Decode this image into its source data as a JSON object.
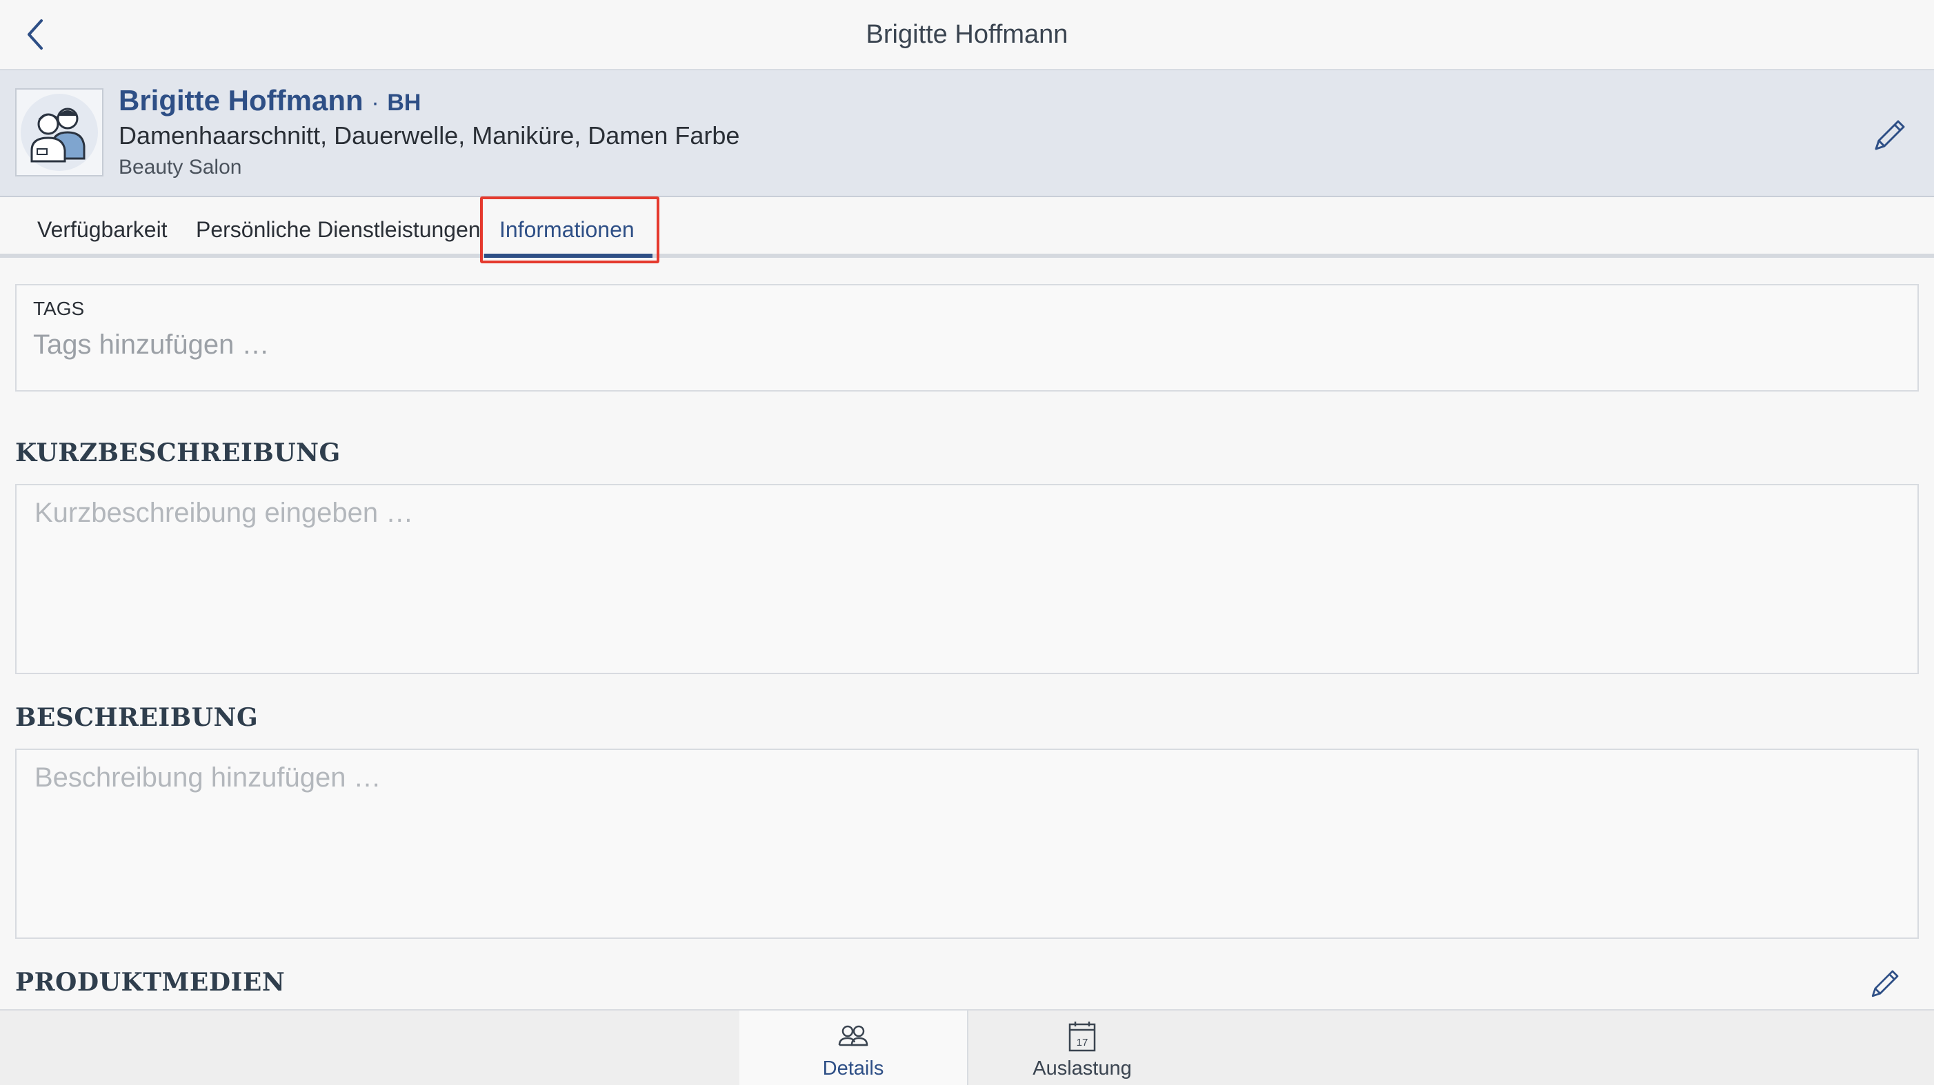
{
  "header": {
    "title": "Brigitte Hoffmann"
  },
  "profile": {
    "name": "Brigitte Hoffmann",
    "separator": "·",
    "initials": "BH",
    "services": "Damenhaarschnitt, Dauerwelle, Maniküre, Damen Farbe",
    "salon": "Beauty Salon"
  },
  "tabs": [
    {
      "label": "Verfügbarkeit"
    },
    {
      "label": "Persönliche Dienstleistungen"
    },
    {
      "label": "Informationen"
    }
  ],
  "active_tab": "Informationen",
  "tags": {
    "label": "TAGS",
    "placeholder": "Tags hinzufügen …"
  },
  "short_description": {
    "title": "KURZBESCHREIBUNG",
    "placeholder": "Kurzbeschreibung eingeben …"
  },
  "description": {
    "title": "BESCHREIBUNG",
    "placeholder": "Beschreibung hinzufügen …"
  },
  "product_media": {
    "title": "PRODUKTMEDIEN"
  },
  "bottom_nav": [
    {
      "label": "Details",
      "icon": "people-icon"
    },
    {
      "label": "Auslastung",
      "icon": "calendar-icon",
      "icon_text": "17"
    }
  ],
  "colors": {
    "accent": "#2e4f86",
    "highlight": "#e53a2e",
    "profile_bg": "#e2e6ed"
  }
}
